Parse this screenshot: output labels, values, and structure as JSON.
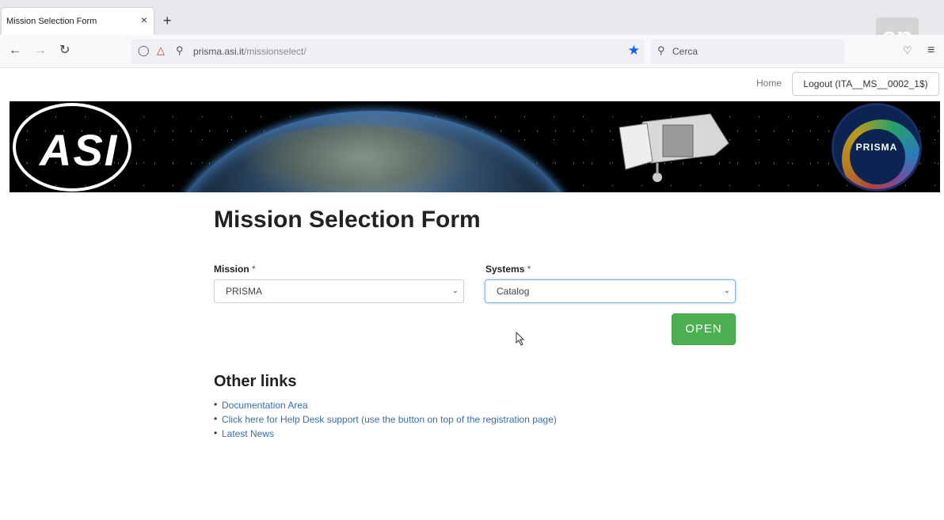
{
  "browser": {
    "tab_title": "Mission Selection Form",
    "tab_close": "×",
    "new_tab": "+",
    "url_host": "prisma.asi.it",
    "url_path": "/missionselect/",
    "search_placeholder": "Cerca",
    "overlay_logo": "ep"
  },
  "header": {
    "home_label": "Home",
    "logout_label": "Logout (ITA__MS__0002_1$)"
  },
  "banner": {
    "asi_logo_text": "ASI",
    "prisma_logo_text": "PRISMA"
  },
  "form": {
    "title": "Mission Selection Form",
    "mission_label": "Mission",
    "systems_label": "Systems",
    "required_mark": "*",
    "mission_value": "PRISMA",
    "systems_value": "Catalog",
    "open_label": "OPEN"
  },
  "other_links": {
    "title": "Other links",
    "items": [
      {
        "label": "Documentation Area"
      },
      {
        "label": "Click here for Help Desk support (use the button on top of the registration page)"
      },
      {
        "label": "Latest News"
      }
    ]
  },
  "colors": {
    "accent": "#4caf50",
    "link": "#3a6ea8",
    "bookmark_star": "#0a60ff"
  }
}
